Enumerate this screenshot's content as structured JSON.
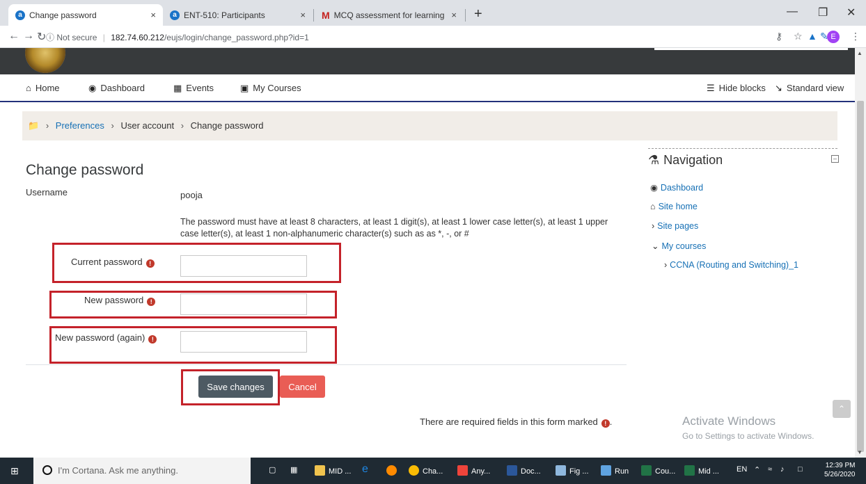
{
  "browser": {
    "tabs": [
      {
        "title": "Change password",
        "favicon": "moodle-a-icon",
        "active": true
      },
      {
        "title": "ENT-510: Participants",
        "favicon": "moodle-a-icon",
        "active": false
      },
      {
        "title": "MCQ assessment for learning ED",
        "favicon": "gmail-icon",
        "active": false
      }
    ],
    "close_glyph": "×",
    "new_tab_glyph": "+",
    "security_label": "Not secure",
    "url_host": "182.74.60.212",
    "url_path": "/eujs/login/change_password.php?id=1",
    "profile_initial": "E"
  },
  "nav": {
    "home": "Home",
    "dashboard": "Dashboard",
    "events": "Events",
    "my_courses": "My Courses",
    "hide_blocks": "Hide blocks",
    "standard_view": "Standard view"
  },
  "breadcrumb": {
    "items": [
      "Preferences",
      "User account",
      "Change password"
    ],
    "separator": "›"
  },
  "form": {
    "title": "Change password",
    "username_label": "Username",
    "username_value": "pooja",
    "rules": "The password must have at least 8 characters, at least 1 digit(s), at least 1 lower case letter(s), at least 1 upper case letter(s), at least 1 non-alphanumeric character(s) such as as *, -, or #",
    "current_password_label": "Current password",
    "new_password_label": "New password",
    "new_password_again_label": "New password (again)",
    "required_glyph": "!",
    "save_label": "Save changes",
    "cancel_label": "Cancel",
    "required_note": "There are required fields in this form marked"
  },
  "navigation_block": {
    "title": "Navigation",
    "dashboard": "Dashboard",
    "site_home": "Site home",
    "site_pages": "Site pages",
    "my_courses": "My courses",
    "course": "CCNA (Routing and Switching)_1"
  },
  "watermark": {
    "line1": "Activate Windows",
    "line2": "Go to Settings to activate Windows."
  },
  "taskbar": {
    "cortana_placeholder": "I'm Cortana. Ask me anything.",
    "apps": [
      "MID ...",
      "Cha...",
      "Any...",
      "Doc...",
      "Fig ...",
      "Run",
      "Cou...",
      "Mid ..."
    ],
    "language": "EN",
    "time": "12:39 PM",
    "date": "5/26/2020"
  }
}
